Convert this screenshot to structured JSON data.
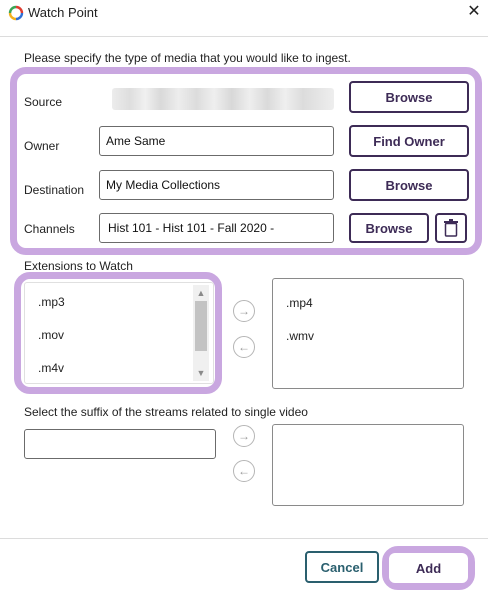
{
  "window": {
    "title": "Watch Point",
    "close_glyph": "✕"
  },
  "instruction": "Please specify the type of media that you would like to ingest.",
  "form": {
    "source": {
      "label": "Source",
      "value": "",
      "browse_label": "Browse"
    },
    "owner": {
      "label": "Owner",
      "value": "Ame Same",
      "button_label": "Find Owner"
    },
    "destination": {
      "label": "Destination",
      "value": "My Media Collections",
      "browse_label": "Browse"
    },
    "channels": {
      "label": "Channels",
      "value": "Hist 101 - Hist 101 - Fall 2020 -",
      "browse_label": "Browse",
      "delete_icon": "trash-icon"
    }
  },
  "extensions": {
    "heading": "Extensions to Watch",
    "available": [
      ".mp3",
      ".mov",
      ".m4v"
    ],
    "selected": [
      ".mp4",
      ".wmv"
    ],
    "move_right_glyph": "→",
    "move_left_glyph": "←"
  },
  "suffix": {
    "heading": "Select the suffix of the streams related to single video",
    "input_value": "",
    "move_right_glyph": "→",
    "move_left_glyph": "←"
  },
  "footer": {
    "cancel_label": "Cancel",
    "add_label": "Add"
  },
  "colors": {
    "highlight": "#c9a7e0",
    "primary_button": "#3d2b56",
    "cancel_button": "#2a5f6e"
  }
}
